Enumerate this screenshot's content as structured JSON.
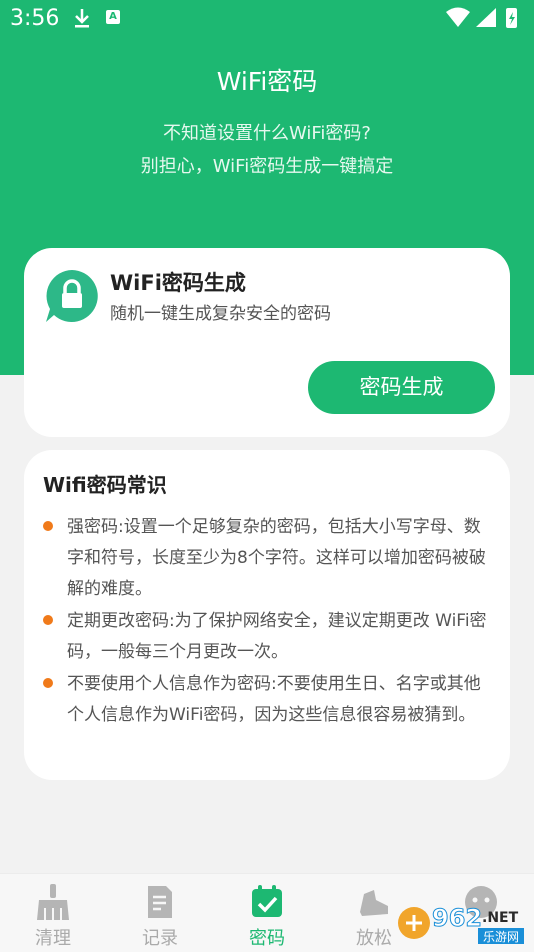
{
  "status_bar": {
    "time": "3:56",
    "notif_letter": "A"
  },
  "header": {
    "title": "WiFi密码",
    "subtitle_line1": "不知道设置什么WiFi密码?",
    "subtitle_line2": "别担心，WiFi密码生成一键搞定"
  },
  "generator": {
    "title": "WiFi密码生成",
    "description": "随机一键生成复杂安全的密码",
    "button_label": "密码生成"
  },
  "tips": {
    "title": "Wifi密码常识",
    "items": [
      {
        "text": "强密码:设置一个足够复杂的密码，包括大小写字母、数字和符号，长度至少为8个字符。这样可以增加密码被破解的难度。"
      },
      {
        "text": "定期更改密码:为了保护网络安全，建议定期更改 WiFi密码，一般每三个月更改一次。"
      },
      {
        "text": "不要使用个人信息作为密码:不要使用生日、名字或其他个人信息作为WiFi密码，因为这些信息很容易被猜到。"
      }
    ]
  },
  "tabbar": {
    "tabs": [
      {
        "label": "清理",
        "icon": "broom-icon"
      },
      {
        "label": "记录",
        "icon": "document-icon"
      },
      {
        "label": "密码",
        "icon": "calendar-check-icon",
        "active": true
      },
      {
        "label": "放松",
        "icon": "shoe-icon"
      },
      {
        "label": "",
        "icon": "face-icon"
      }
    ]
  },
  "watermark": {
    "text1": "962",
    "text2": ".NET",
    "text3": "乐游网"
  },
  "colors": {
    "brand": "#1db872",
    "bullet": "#f07a1a",
    "background": "#f2f2f2"
  }
}
